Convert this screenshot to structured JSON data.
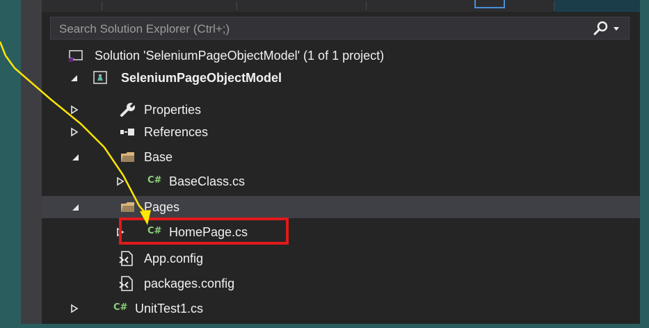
{
  "search": {
    "placeholder": "Search Solution Explorer (Ctrl+;)",
    "icon": "search-icon"
  },
  "tree": {
    "solution_label": "Solution 'SeleniumPageObjectModel' (1 of 1 project)",
    "project_label": "SeleniumPageObjectModel",
    "properties_label": "Properties",
    "references_label": "References",
    "base_folder_label": "Base",
    "base_class_label": "BaseClass.cs",
    "pages_folder_label": "Pages",
    "home_page_label": "HomePage.cs",
    "app_config_label": "App.config",
    "packages_config_label": "packages.config",
    "unit_test_label": "UnitTest1.cs",
    "cs_badge": "C#"
  },
  "colors": {
    "highlight": "#e11a1a",
    "annotation_arrow": "#ffe600",
    "selected_row": "#3f3f46",
    "panel_bg": "#252526"
  }
}
